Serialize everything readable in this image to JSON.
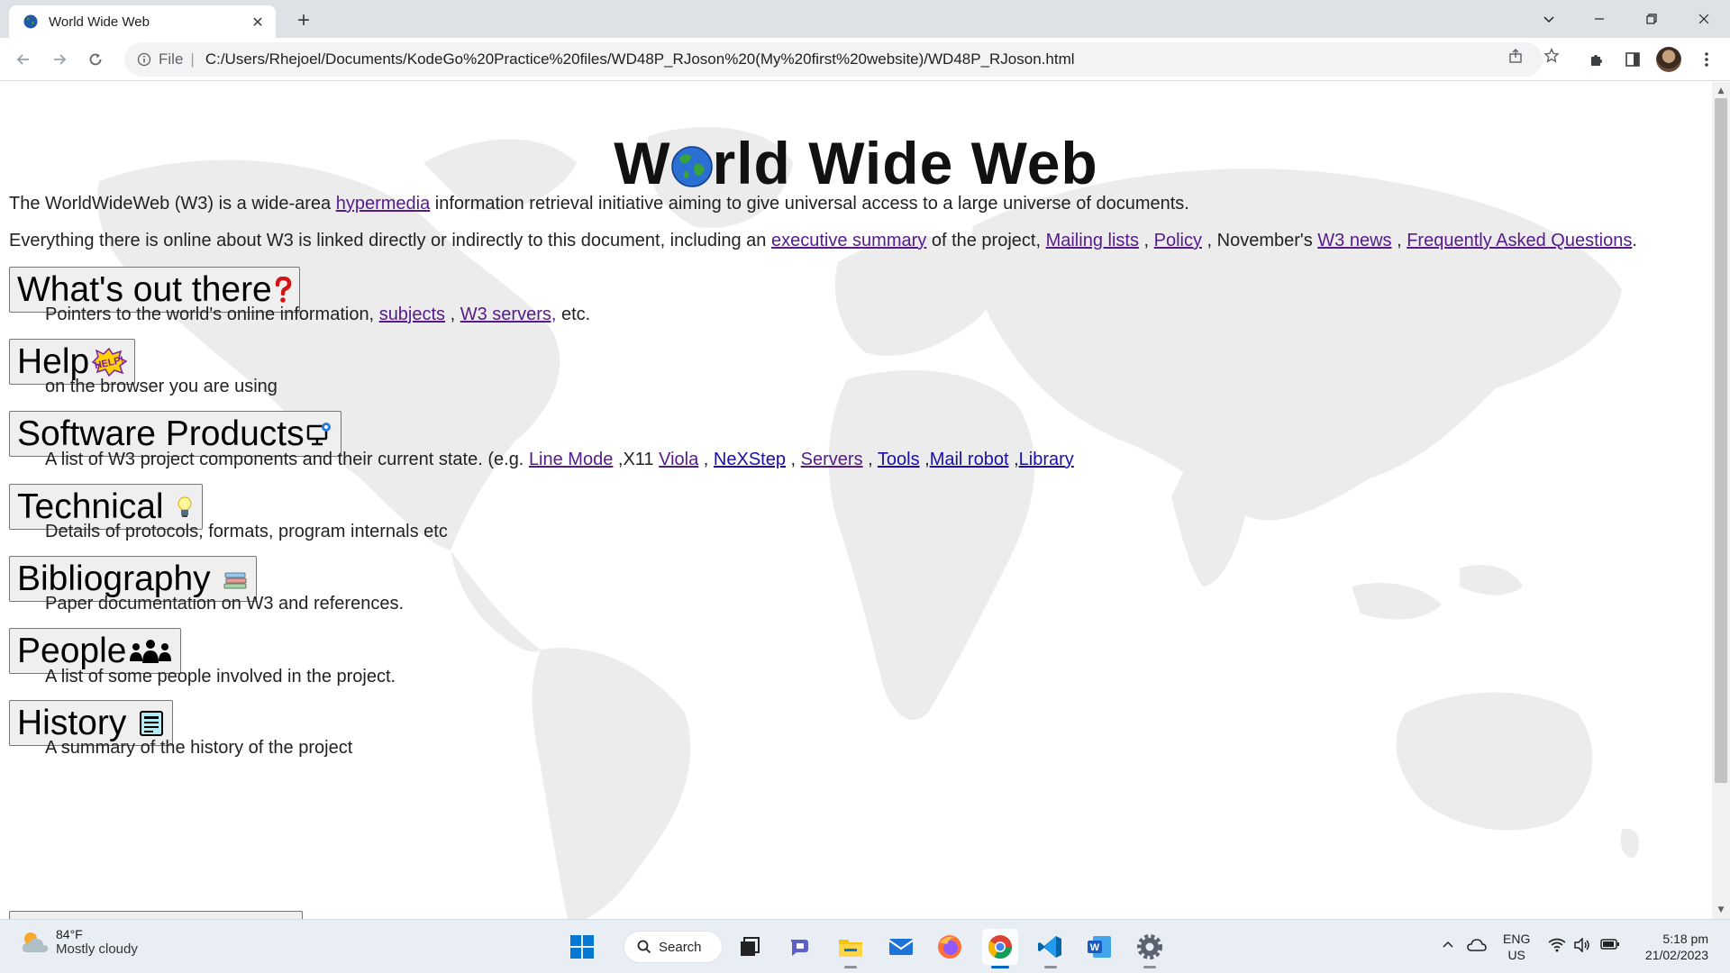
{
  "browser": {
    "tab_title": "World Wide Web",
    "url_scheme": "File",
    "url": "C:/Users/Rhejoel/Documents/KodeGo%20Practice%20files/WD48P_RJoson%20(My%20first%20website)/WD48P_RJoson.html"
  },
  "page": {
    "title_before": "W",
    "title_after": "rld Wide Web",
    "intro": {
      "text1": "The WorldWideWeb (W3) is a wide-area ",
      "link_hypermedia": "hypermedia",
      "text2": " information retrieval initiative aiming to give universal access to a large universe of documents."
    },
    "everything": {
      "text1": "Everything there is online about W3 is linked directly or indirectly to this document, including an ",
      "link_exec": "executive summary",
      "text2": " of the project, ",
      "link_mailing": "Mailing lists",
      "text3": " , ",
      "link_policy": "Policy",
      "text4": " , November's ",
      "link_news": "W3 news",
      "text5": " , ",
      "link_faq": "Frequently Asked Questions",
      "text6": "."
    },
    "sections": {
      "whats_out": {
        "label": "What's out there",
        "desc1": "Pointers to the world's online information, ",
        "link_subjects": "subjects",
        "desc2": " , ",
        "link_servers": "W3 servers,",
        "desc3": " etc."
      },
      "help": {
        "label": "Help",
        "icon_text": "HELP!",
        "desc": "on the browser you are using"
      },
      "software": {
        "label": "Software Products",
        "desc1": "A list of W3 project components and their current state. (e.g. ",
        "link_linemode": "Line Mode",
        "desc2": " ,X11 ",
        "link_viola": "Viola",
        "desc3": " , ",
        "link_nexstep": "NeXStep",
        "desc4": " , ",
        "link_servers": "Servers",
        "desc5": " , ",
        "link_tools": "Tools",
        "desc6": " ,",
        "link_mailrobot": "Mail robot",
        "desc7": " ,",
        "link_library": "Library"
      },
      "technical": {
        "label": "Technical ",
        "desc": "Details of protocols, formats, program internals etc"
      },
      "bibliography": {
        "label": "Bibliography ",
        "desc": "Paper documentation on W3 and references."
      },
      "people": {
        "label": "People",
        "desc": "A list of some people involved in the project."
      },
      "history": {
        "label": "History ",
        "desc": "A summary of the history of the project"
      }
    }
  },
  "taskbar": {
    "weather_temp": "84°F",
    "weather_cond": "Mostly cloudy",
    "search_label": "Search",
    "lang_top": "ENG",
    "lang_bottom": "US",
    "time": "5:18 pm",
    "date": "21/02/2023"
  },
  "colors": {
    "visited_link": "#551a8b",
    "unvisited_link": "#1a0dab",
    "tab_strip": "#dee1e6",
    "taskbar": "#e9eef5"
  }
}
